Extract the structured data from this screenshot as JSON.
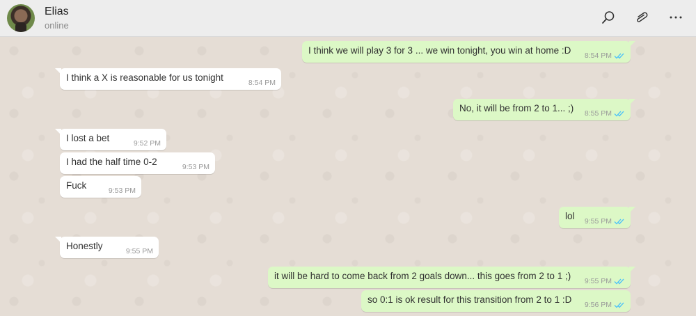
{
  "header": {
    "contact_name": "Elias",
    "status": "online",
    "icons": [
      "search-icon",
      "attach-icon",
      "more-options-icon"
    ]
  },
  "colors": {
    "incoming_bubble": "#ffffff",
    "outgoing_bubble": "#dcf8c6",
    "read_ticks": "#4fc3f7",
    "header_bg": "#ededed",
    "chat_bg": "#e5ddd5"
  },
  "messages": [
    {
      "direction": "out",
      "text": "I think we will play 3 for 3 ... we win tonight, you win at home :D",
      "time": "8:54 PM",
      "read": true
    },
    {
      "direction": "in",
      "text": "I think a X is reasonable for us tonight",
      "time": "8:54 PM"
    },
    {
      "direction": "out",
      "text": "No, it will be from 2 to 1... ;)",
      "time": "8:55 PM",
      "read": true
    },
    {
      "direction": "in",
      "text": "I lost a bet",
      "time": "9:52 PM"
    },
    {
      "direction": "in",
      "text": "I had the half time 0-2",
      "time": "9:53 PM"
    },
    {
      "direction": "in",
      "text": "Fuck",
      "time": "9:53 PM"
    },
    {
      "direction": "out",
      "text": "lol",
      "time": "9:55 PM",
      "read": true
    },
    {
      "direction": "in",
      "text": "Honestly",
      "time": "9:55 PM"
    },
    {
      "direction": "out",
      "text": "it will be hard to come back from 2 goals down... this goes from 2 to 1 ;)",
      "time": "9:55 PM",
      "read": true
    },
    {
      "direction": "out",
      "text": "so 0:1 is ok result for this transition from 2 to 1 :D",
      "time": "9:56 PM",
      "read": true
    }
  ]
}
